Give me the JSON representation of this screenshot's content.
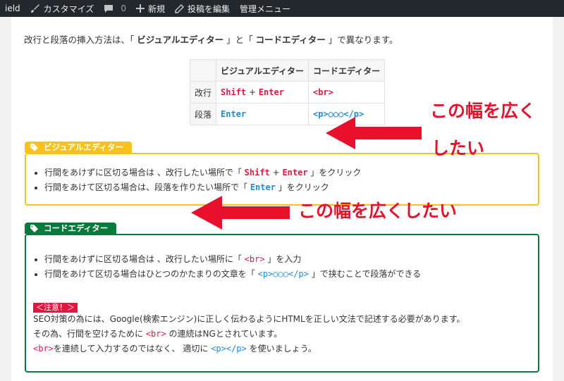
{
  "adminbar": {
    "site": "ield",
    "customize": "カスタマイズ",
    "comments_count": "0",
    "new": "新規",
    "edit": "投稿を編集",
    "manage": "管理メニュー"
  },
  "intro": {
    "p1": "改行と段落の挿入方法は、「 ",
    "visual": "ビジュアルエディター",
    "p2": " 」と「 ",
    "code": "コードエディター",
    "p3": " 」で異なります。"
  },
  "table": {
    "headers": [
      "",
      "ビジュアルエディター",
      "コードエディター"
    ],
    "rows": [
      {
        "label": "改行",
        "visual_key1": "Shift",
        "plus": " + ",
        "visual_key2": "Enter",
        "code": "<br>"
      },
      {
        "label": "段落",
        "visual": "Enter",
        "code": "<p>○○○</p>"
      }
    ]
  },
  "visual_box": {
    "title": "ビジュアルエディター",
    "items": [
      {
        "pre": "行間をあけずに区切る場合は 、改行したい場所で「 ",
        "key1": "Shift",
        "plus": " + ",
        "key2": "Enter",
        "post": " 」をクリック"
      },
      {
        "pre": "行間をあけて区切る場合は、段落を作りたい場所で「 ",
        "key": "Enter",
        "post": " 」をクリック"
      }
    ]
  },
  "code_box": {
    "title": "コードエディター",
    "items": [
      {
        "pre": "行間をあけずに区切る場合は 、改行したい場所に「 ",
        "code": "<br>",
        "post": " 」を入力"
      },
      {
        "pre": "行間をあけて区切る場合はひとつのかたまりの文章を「 ",
        "code": "<p>○○○</p>",
        "post": " 」で挟むことで段落ができる"
      }
    ],
    "caution": "＜注意！＞",
    "lines": [
      {
        "text": "SEO対策の為には、Google(検索エンジン)に正しく伝わるようにHTMLを正しい文法で記述する必要があります。"
      },
      {
        "pre": "その為、行間を空けるために ",
        "code": "<br>",
        "post": " の連続はNGとされています。"
      },
      {
        "code1": "<br>",
        "mid": "を連続して入力するのではなく、 適切に ",
        "code2": "<p></p>",
        "post": " を使いましょう。"
      }
    ]
  },
  "annotations": {
    "top_line1": "この幅を広く",
    "top_line2": "したい",
    "bottom": "この幅を広くしたい"
  },
  "colors": {
    "adminbar": "#23282d",
    "yellow": "#f9c21b",
    "green": "#0a7a3c",
    "red": "#e3163f",
    "blue": "#2389d6",
    "annotation": "#e8102a"
  }
}
